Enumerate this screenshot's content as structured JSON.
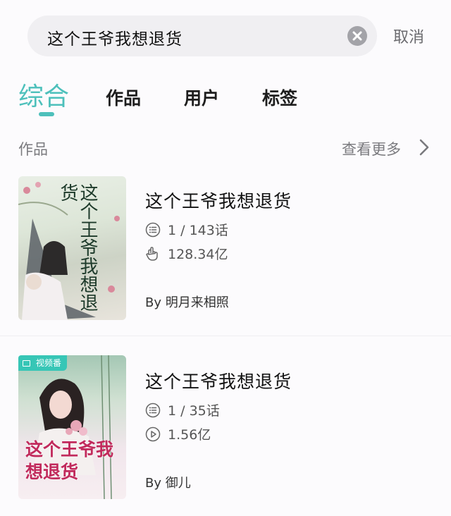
{
  "search": {
    "query": "这个王爷我想退货",
    "cancel_label": "取消"
  },
  "tabs": [
    {
      "label": "综合",
      "active": true
    },
    {
      "label": "作品",
      "active": false
    },
    {
      "label": "用户",
      "active": false
    },
    {
      "label": "标签",
      "active": false
    }
  ],
  "section": {
    "title": "作品",
    "more_label": "查看更多"
  },
  "works": [
    {
      "title": "这个王爷我想退货",
      "chapters": "1 / 143话",
      "stat": "128.34亿",
      "stat_icon": "like-icon",
      "author": "By 明月来相照",
      "cover_text": "这个王爷我想退货",
      "badge": ""
    },
    {
      "title": "这个王爷我想退货",
      "chapters": "1 / 35话",
      "stat": "1.56亿",
      "stat_icon": "play-icon",
      "author": "By 御儿",
      "cover_text": "这个王爷我想退货",
      "badge": "视频番"
    }
  ],
  "colors": {
    "accent": "#4dc0bb",
    "badge": "#37c6b6"
  }
}
